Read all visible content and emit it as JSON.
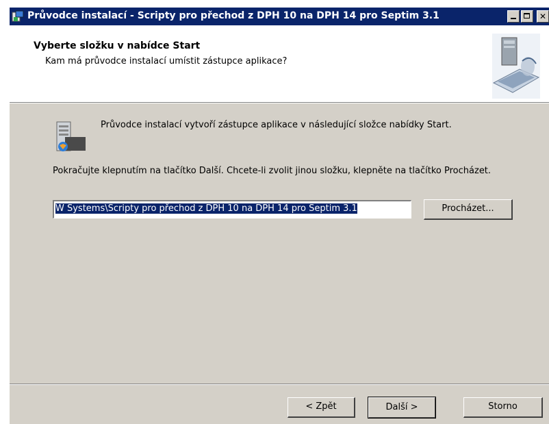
{
  "window": {
    "title": "Průvodce instalací - Scripty pro přechod z DPH 10 na DPH 14 pro Septim 3.1",
    "close_glyph": "✕"
  },
  "header": {
    "title": "Vyberte složku v nabídce Start",
    "subtitle": "Kam má průvodce instalací umístit zástupce aplikace?"
  },
  "body": {
    "intro": "Průvodce instalací vytvoří zástupce aplikace v následující složce nabídky Start.",
    "continue": "Pokračujte klepnutím na tlačítko Další. Chcete-li zvolit jinou složku, klepněte na tlačítko Procházet.",
    "folder_value": "W Systems\\Scripty pro přechod z DPH 10 na DPH 14 pro Septim 3.1",
    "browse_label": "Procházet..."
  },
  "footer": {
    "back_label": "< Zpět",
    "next_label": "Další >",
    "cancel_label": "Storno"
  },
  "colors": {
    "titlebar": "#0a246a",
    "face": "#d4d0c8",
    "selection": "#0a246a"
  },
  "icons": {
    "title": "installer-icon",
    "header": "computer-wizard-icon",
    "folder": "start-menu-folder-icon"
  }
}
